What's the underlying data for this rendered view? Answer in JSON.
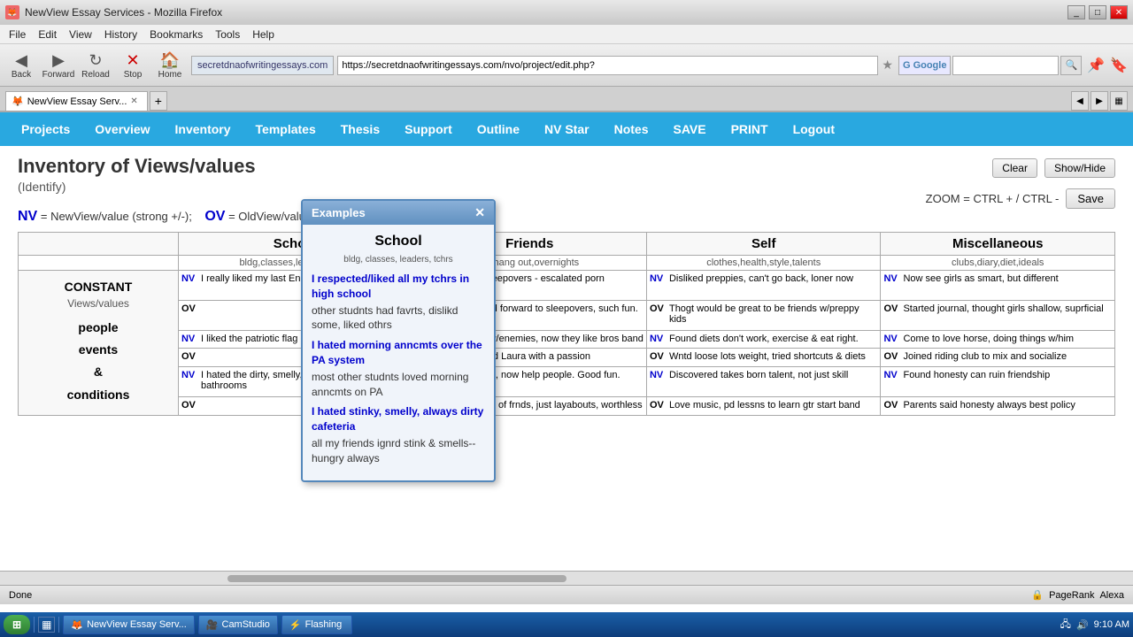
{
  "browser": {
    "title": "NewView Essay Services - Mozilla Firefox",
    "tab_label": "NewView Essay Serv...",
    "address": "https://secretdnaofwritingessays.com/nvo/project/edit.php?",
    "address_domain": "secretdnaofwritingessays.com",
    "search_placeholder": "Google",
    "menu": [
      "File",
      "Edit",
      "View",
      "History",
      "Bookmarks",
      "Tools",
      "Help"
    ],
    "nav_buttons": {
      "back": "Back",
      "forward": "Forward",
      "reload": "Reload",
      "stop": "Stop",
      "home": "Home"
    }
  },
  "app_nav": {
    "items": [
      "Projects",
      "Overview",
      "Inventory",
      "Templates",
      "Thesis",
      "Support",
      "Outline",
      "NV Star",
      "Notes",
      "SAVE",
      "PRINT",
      "Logout"
    ]
  },
  "page": {
    "title": "Inventory of Views/values",
    "subtitle": "(Identify)",
    "zoom_text": "ZOOM = CTRL + / CTRL -",
    "buttons": {
      "clear": "Clear",
      "show_hide": "Show/Hide",
      "save": "Save"
    },
    "legend": "NV = NewView/value (strong +/-);  OV = OldView/value (reverse of NV; strong +/-)",
    "nv_label": "NV",
    "ov_label": "OV"
  },
  "popup": {
    "title": "Examples",
    "school_title": "School",
    "sub_items": "bldg, classes, leaders, tchrs",
    "entries": [
      {
        "nv": "I respected/liked all my tchrs in high school",
        "ov": "other studnts had favrts, dislikd some, liked othrs"
      },
      {
        "nv": "I hated morning anncmts over the PA system",
        "ov": "most other studnts loved morning anncmts on PA"
      },
      {
        "nv": "I hated stinky, smelly, always dirty cafeteria",
        "ov": "all my friends ignrd stink & smells--hungry always"
      }
    ]
  },
  "table": {
    "constant_label": "CONSTANT",
    "constant_sub": "Views/values",
    "constant_items": "people\nevents\n&\nconditions",
    "columns": [
      {
        "header": "School",
        "sub_items": "bldg,classes,leaders,tchrs",
        "rows": [
          {
            "nv_marker": "NV",
            "nv_text": "I really liked my last Engl tchr in hi school",
            "ov_text": ""
          },
          {
            "nv_marker": "NV",
            "nv_text": "I liked the patriotic flag ceremony every day",
            "ov_text": ""
          },
          {
            "nv_marker": "NV",
            "nv_text": "I hated the dirty, smelly, always messy bathrooms",
            "ov_text": ""
          }
        ]
      },
      {
        "header": "Friends",
        "sub_items": "un,hang out,overnights",
        "rows": [
          {
            "nv_marker": "NV",
            "nv_text": "Now dread sleepovers - escalated porn viewings",
            "ov_text": "Always looked forward to sleepovers, such fun."
          },
          {
            "nv_marker": "NV",
            "nv_text": "Best friends w/enemies, now they like bros band",
            "ov_text": "Hated Jen and Laura with a passion"
          },
          {
            "nv_marker": "NV",
            "nv_text": "Got civic spirit, now help people. Good fun.",
            "ov_text": "Felt our group of frnds, just layabouts, worthless"
          }
        ]
      },
      {
        "header": "Self",
        "sub_items": "clothes,health,style,talents",
        "rows": [
          {
            "nv_marker": "NV",
            "nv_text": "Disliked preppies, can't go back, loner now",
            "ov_text": "Thogt would be great to be friends w/preppy kids"
          },
          {
            "nv_marker": "NV",
            "nv_text": "Found diets don't work, exercise & eat right.",
            "ov_text": "Wntd loose lots weight, tried shortcuts & diets"
          },
          {
            "nv_marker": "NV",
            "nv_text": "Discovered takes born talent, not just skill",
            "ov_text": "Love music, pd lessns to learn gtr start band"
          }
        ]
      },
      {
        "header": "Miscellaneous",
        "sub_items": "clubs,diary,diet,ideals",
        "rows": [
          {
            "nv_marker": "NV",
            "nv_text": "Now see girls as smart, but different",
            "ov_text": "Started journal, thought girls shallow, suprficial"
          },
          {
            "nv_marker": "NV",
            "nv_text": "Come to love horse, doing things w/him",
            "ov_text": "Joined riding club to mix and socialize"
          },
          {
            "nv_marker": "NV",
            "nv_text": "Found honesty can ruin friendship",
            "ov_text": "Parents said honesty always best policy"
          }
        ]
      }
    ]
  },
  "status": {
    "left": "Done",
    "right_items": [
      "PageRank",
      "Alexa"
    ]
  },
  "taskbar": {
    "start": "⊞",
    "items": [
      "NewView Essay Serv...",
      "CamStudio",
      "Flashing"
    ],
    "time": "9:10 AM"
  }
}
